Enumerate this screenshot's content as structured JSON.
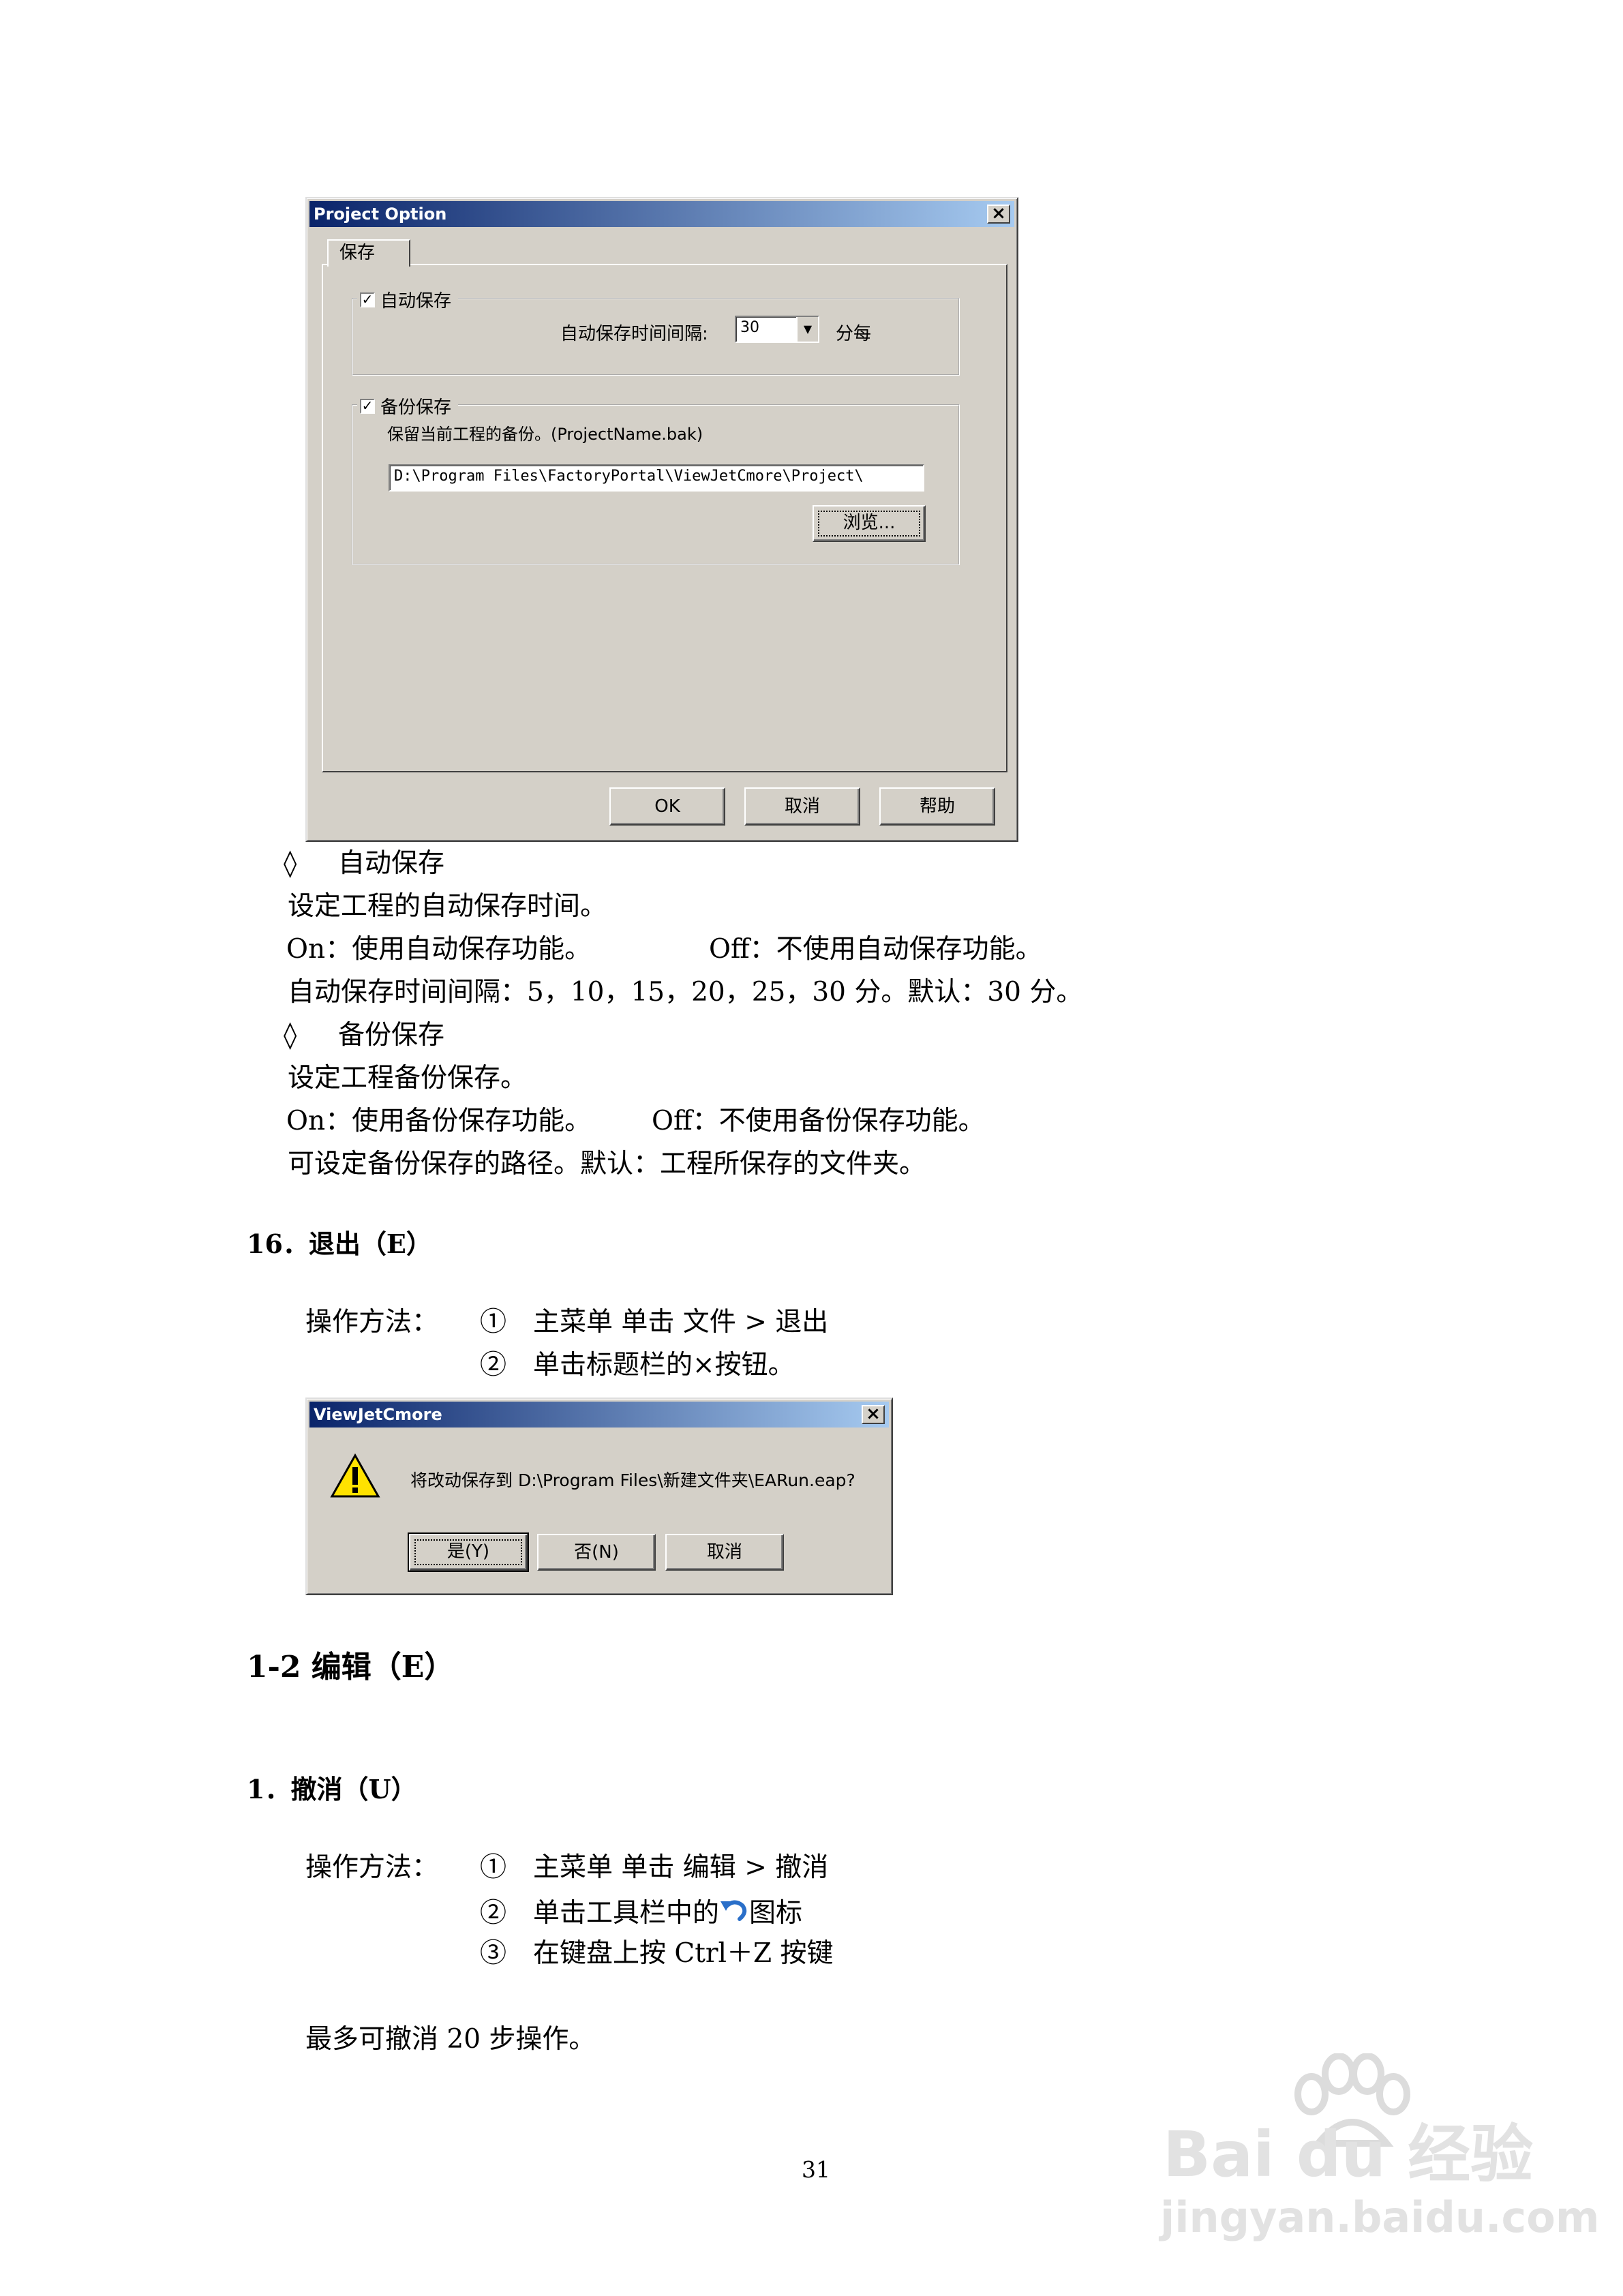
{
  "project_dialog": {
    "title": "Project Option",
    "close_glyph": "×",
    "tab_label": "保存",
    "autosave_group": {
      "label": "自动保存",
      "checked": true,
      "interval_label": "自动保存时间间隔:",
      "interval_value": "30",
      "unit": "分每"
    },
    "backup_group": {
      "label": "备份保存",
      "checked": true,
      "desc": "保留当前工程的备份。(ProjectName.bak)",
      "path": "D:\\Program Files\\FactoryPortal\\ViewJetCmore\\Project\\",
      "browse_label": "浏览..."
    },
    "ok_label": "OK",
    "cancel_label": "取消",
    "help_label": "帮助"
  },
  "autosave_section": {
    "bullet": "◊",
    "title": "自动保存",
    "line1": "设定工程的自动保存时间。",
    "on_text": "On：使用自动保存功能。",
    "off_text": "Off：不使用自动保存功能。",
    "interval_text": "自动保存时间间隔：5，10，15，20，25，30 分。默认：30 分。"
  },
  "backup_section": {
    "bullet": "◊",
    "title": "备份保存",
    "line1": "设定工程备份保存。",
    "on_text": "On：使用备份保存功能。",
    "off_text": "Off：不使用备份保存功能。",
    "path_text": "可设定备份保存的路径。默认：工程所保存的文件夹。"
  },
  "exit_section": {
    "heading": "16．退出（E）",
    "method_label": "操作方法：",
    "step1": "①　主菜单  单击  文件  >  退出",
    "step2": "②　单击标题栏的×按钮。"
  },
  "exit_dialog": {
    "title": "ViewJetCmore",
    "close_glyph": "×",
    "warning_glyph": "!",
    "message": "将改动保存到 D:\\Program Files\\新建文件夹\\EARun.eap?",
    "yes_label": "是(Y)",
    "no_label": "否(N)",
    "cancel_label": "取消"
  },
  "edit_section": {
    "heading": "1-2  编辑（E）"
  },
  "undo_section": {
    "heading": "1．撤消（U）",
    "method_label": "操作方法：",
    "step1": "①　主菜单  单击  编辑  >  撤消",
    "step2_pre": "②　单击工具栏中的",
    "step2_post": "图标",
    "step3": "③　在键盘上按 Ctrl＋Z 按键",
    "note": "最多可撤消 20 步操作。"
  },
  "page_number": "31",
  "watermark": {
    "brand": "Bai du 经验",
    "url": "jingyan.baidu.com"
  }
}
